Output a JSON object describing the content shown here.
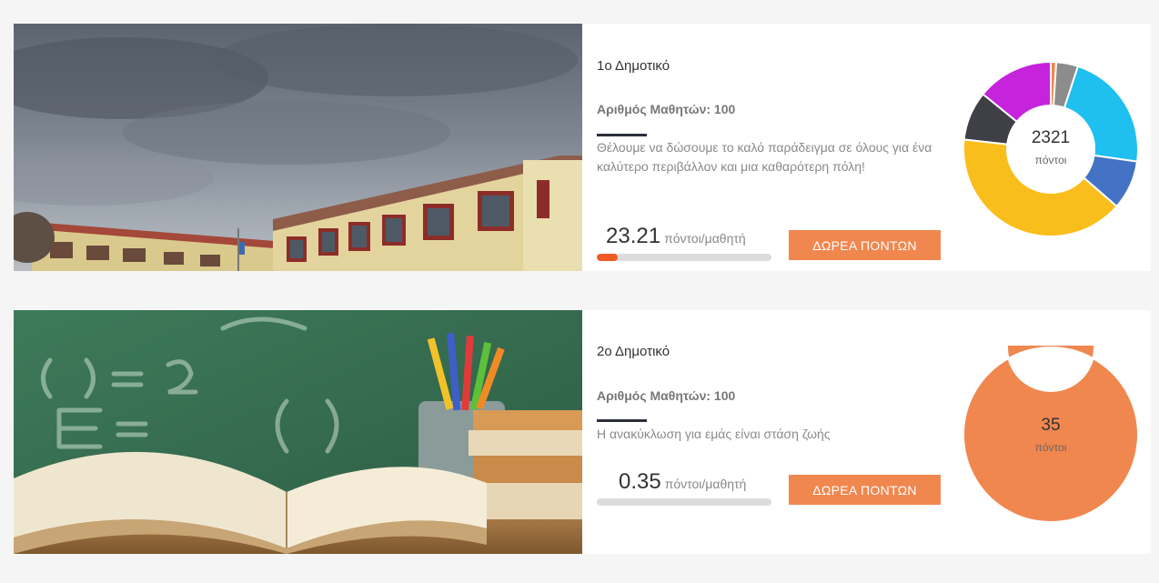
{
  "schools": [
    {
      "name": "1ο Δημοτικό",
      "students_label": "Αριθμός Μαθητών: 100",
      "description": "Θέλουμε να δώσουμε το καλό παράδειγμα σε όλους για ένα καλύτερο περιβάλλον και μια καθαρότερη πόλη!",
      "points_per_student": "23.21",
      "points_per_student_unit": "πόντοι/μαθητή",
      "progress": 0.12,
      "donate_label": "ΔΩΡΕΑ ΠΟΝΤΩΝ",
      "total_points": "2321",
      "total_points_unit": "πόντοι",
      "image": "school building under cloudy sky",
      "chart_data": {
        "type": "pie",
        "style": "donut",
        "values": [
          1,
          4,
          22,
          9,
          40,
          9,
          14
        ],
        "colors": [
          "#f0874f",
          "#8c8c8c",
          "#1fbff0",
          "#4472c4",
          "#f9be1b",
          "#3f4047",
          "#c523dc"
        ]
      }
    },
    {
      "name": "2ο Δημοτικό",
      "students_label": "Αριθμός Μαθητών: 100",
      "description": "Η ανακύκλωση για εμάς είναι στάση ζωής",
      "points_per_student": "0.35",
      "points_per_student_unit": "πόντοι/μαθητή",
      "progress": 0.0,
      "donate_label": "ΔΩΡΕΑ ΠΟΝΤΩΝ",
      "total_points": "35",
      "total_points_unit": "πόντοι",
      "image": "books and pencils in front of a chalkboard",
      "chart_data": {
        "type": "pie",
        "style": "donut",
        "values": [
          100
        ],
        "colors": [
          "#f0874f"
        ]
      }
    }
  ]
}
